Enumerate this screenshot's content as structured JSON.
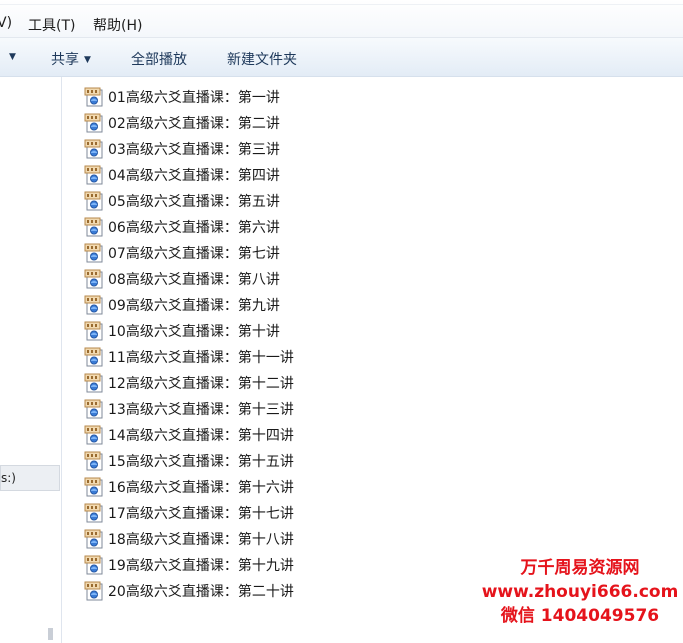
{
  "menubar": {
    "items": [
      {
        "label": "V)"
      },
      {
        "label": "工具(T)"
      },
      {
        "label": "帮助(H)"
      }
    ]
  },
  "toolbar": {
    "share_label": "共享",
    "playall_label": "全部播放",
    "newfolder_label": "新建文件夹"
  },
  "navpane": {
    "drive_label": "s:)"
  },
  "files": [
    "01高级六爻直播课：第一讲",
    "02高级六爻直播课：第二讲",
    "03高级六爻直播课：第三讲",
    "04高级六爻直播课：第四讲",
    "05高级六爻直播课：第五讲",
    "06高级六爻直播课：第六讲",
    "07高级六爻直播课：第七讲",
    "08高级六爻直播课：第八讲",
    "09高级六爻直播课：第九讲",
    "10高级六爻直播课：第十讲",
    "11高级六爻直播课：第十一讲",
    "12高级六爻直播课：第十二讲",
    "13高级六爻直播课：第十三讲",
    "14高级六爻直播课：第十四讲",
    "15高级六爻直播课：第十五讲",
    "16高级六爻直播课：第十六讲",
    "17高级六爻直播课：第十七讲",
    "18高级六爻直播课：第十八讲",
    "19高级六爻直播课：第十九讲",
    "20高级六爻直播课：第二十讲"
  ],
  "watermark": {
    "line1": "万千周易资源网",
    "line2": "www.zhouyi666.com",
    "line3": "微信 1404049576"
  },
  "icons": {
    "file": "video-file-icon",
    "caret": "caret-down-icon"
  },
  "colors": {
    "watermark": "#e5131b",
    "toolbar_text": "#1e395b"
  }
}
